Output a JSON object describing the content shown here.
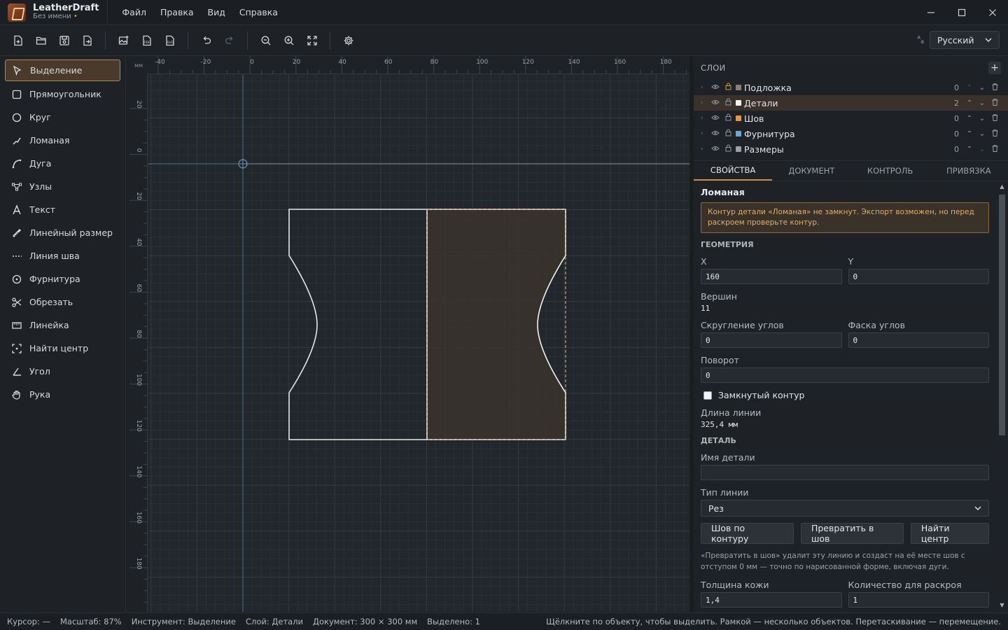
{
  "app": {
    "name": "LeatherDraft",
    "doc": "Без имени",
    "dirty_dot": "•"
  },
  "menu": [
    "Файл",
    "Правка",
    "Вид",
    "Справка"
  ],
  "language": {
    "selected": "Русский"
  },
  "tools": [
    {
      "label": "Выделение",
      "icon": "cursor-icon",
      "active": true
    },
    {
      "label": "Прямоугольник",
      "icon": "rectangle-icon"
    },
    {
      "label": "Круг",
      "icon": "circle-icon"
    },
    {
      "label": "Ломаная",
      "icon": "polyline-icon"
    },
    {
      "label": "Дуга",
      "icon": "arc-icon"
    },
    {
      "label": "Узлы",
      "icon": "nodes-icon"
    },
    {
      "label": "Текст",
      "icon": "text-icon"
    },
    {
      "label": "Линейный размер",
      "icon": "dimension-icon"
    },
    {
      "label": "Линия шва",
      "icon": "seam-line-icon"
    },
    {
      "label": "Фурнитура",
      "icon": "hardware-icon"
    },
    {
      "label": "Обрезать",
      "icon": "scissors-icon"
    },
    {
      "label": "Линейка",
      "icon": "ruler-icon"
    },
    {
      "label": "Найти центр",
      "icon": "center-icon"
    },
    {
      "label": "Угол",
      "icon": "angle-icon"
    },
    {
      "label": "Рука",
      "icon": "hand-icon"
    }
  ],
  "ruler": {
    "unit": "мм",
    "top_ticks": [
      "-40",
      "-20",
      "0",
      "20",
      "40",
      "60",
      "80",
      "100",
      "120",
      "140",
      "160",
      "180"
    ],
    "left_ticks": [
      "20",
      "0",
      "20",
      "40",
      "60",
      "80",
      "100",
      "120",
      "140",
      "160",
      "180"
    ]
  },
  "layers": {
    "title": "СЛОИ",
    "add": "+",
    "items": [
      {
        "name": "Подложка",
        "count": "0",
        "color": "#8c7f70"
      },
      {
        "name": "Детали",
        "count": "2",
        "color": "#f2f2f2",
        "active": true
      },
      {
        "name": "Шов",
        "count": "0",
        "color": "#e39a3a"
      },
      {
        "name": "Фурнитура",
        "count": "0",
        "color": "#6aa7e0"
      },
      {
        "name": "Размеры",
        "count": "0",
        "color": "#9aa0a6"
      }
    ]
  },
  "tabs": [
    "СВОЙСТВА",
    "ДОКУМЕНТ",
    "КОНТРОЛЬ",
    "ПРИВЯЗКА"
  ],
  "props": {
    "object": "Ломаная",
    "warning": "Контур детали «Ломаная» не замкнут. Экспорт возможен, но перед раскроем проверьте контур.",
    "geometry": "ГЕОМЕТРИЯ",
    "x_label": "X",
    "x": "160",
    "y_label": "Y",
    "y": "0",
    "vertices_label": "Вершин",
    "vertices": "11",
    "round_label": "Скругление углов",
    "round": "0",
    "chamfer_label": "Фаска углов",
    "chamfer": "0",
    "rotation_label": "Поворот",
    "rotation": "0",
    "closed_label": "Замкнутый контур",
    "length_label": "Длина линии",
    "length": "325,4 мм",
    "detail": "ДЕТАЛЬ",
    "name_label": "Имя детали",
    "name": "",
    "line_type_label": "Тип линии",
    "line_type": "Рез",
    "btn_seam": "Шов по контуру",
    "btn_convert": "Превратить в шов",
    "btn_center": "Найти центр",
    "hint": "«Превратить в шов» удалит эту линию и создаст на её месте шов с отступом 0 мм — точно по нарисованной форме, включая дуги.",
    "thickness_label": "Толщина кожи",
    "thickness": "1,4",
    "qty_label": "Количество для раскроя",
    "qty": "1"
  },
  "status": {
    "cursor": "Курсор: —",
    "zoom": "Масштаб: 87%",
    "tool": "Инструмент: Выделение",
    "layer": "Слой: Детали",
    "document": "Документ: 300 × 300 мм",
    "selected": "Выделено: 1",
    "help": "Щёлкните по объекту, чтобы выделить. Рамкой — несколько объектов. Перетаскивание — перемещение."
  },
  "colors": {
    "accent": "#c48a4e",
    "selection_fill": "#3b342d",
    "warning": "#e0b068"
  }
}
